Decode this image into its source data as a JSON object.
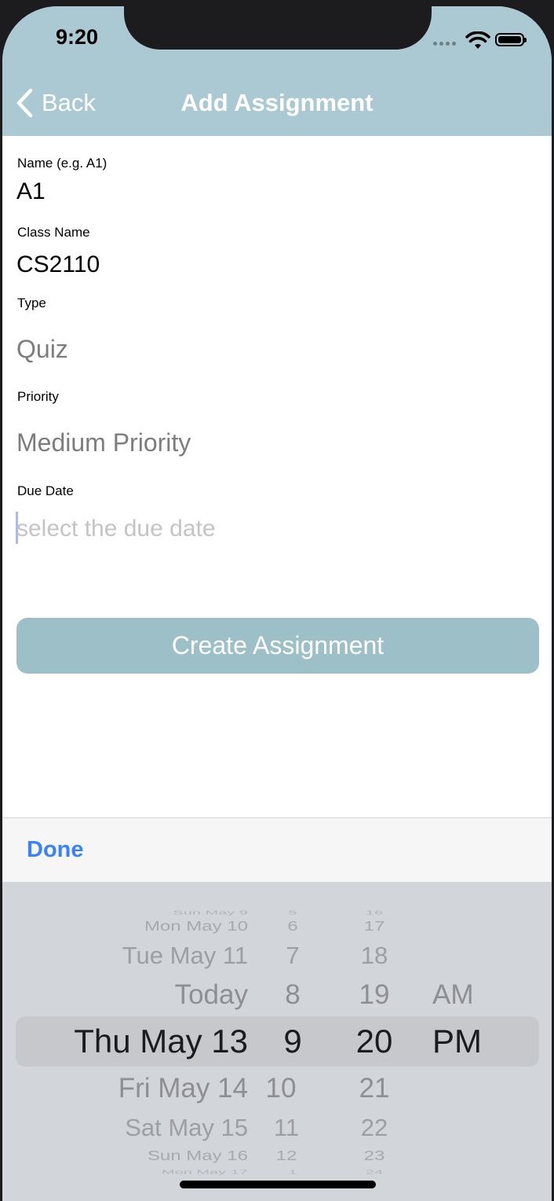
{
  "status_bar": {
    "time": "9:20"
  },
  "nav": {
    "back_label": "Back",
    "title": "Add Assignment"
  },
  "form": {
    "name_label": "Name (e.g. A1)",
    "name_value": "A1",
    "class_label": "Class Name",
    "class_value": "CS2110",
    "type_label": "Type",
    "type_value": "Quiz",
    "priority_label": "Priority",
    "priority_value": "Medium Priority",
    "due_label": "Due Date",
    "due_placeholder": "select the due date",
    "create_button": "Create Assignment"
  },
  "picker": {
    "done_label": "Done",
    "dates": [
      "Sun May 9",
      "Mon May 10",
      "Tue May 11",
      "Today",
      "Thu May 13",
      "Fri May 14",
      "Sat May 15",
      "Sun May 16",
      "Mon May 17"
    ],
    "hours": [
      "5",
      "6",
      "7",
      "8",
      "9",
      "10",
      "11",
      "12",
      "1"
    ],
    "minutes": [
      "16",
      "17",
      "18",
      "19",
      "20",
      "21",
      "22",
      "23",
      "24"
    ],
    "ampm": [
      "AM",
      "PM"
    ],
    "selected": {
      "date": "Thu May 13",
      "hour": "9",
      "minute": "20",
      "ampm": "PM"
    }
  },
  "colors": {
    "nav_background": "#abc9d2",
    "button_background": "#9dbfc8",
    "done_blue": "#3a82f6",
    "picker_background": "#d2d5da"
  },
  "icons": [
    "chevron-left-icon",
    "wifi-icon",
    "battery-icon",
    "cellular-signal-icon"
  ]
}
